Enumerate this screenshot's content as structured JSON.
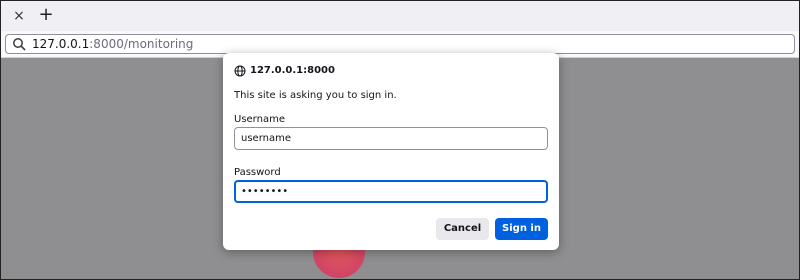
{
  "tabs": {
    "close_glyph": "×",
    "new_tab_glyph": "+"
  },
  "urlbar": {
    "host": "127.0.0.1",
    "rest": ":8000/monitoring"
  },
  "dialog": {
    "host": "127.0.0.1:8000",
    "message": "This site is asking you to sign in.",
    "username_label": "Username",
    "username_value": "username",
    "password_label": "Password",
    "password_value": "••••••••",
    "cancel_label": "Cancel",
    "signin_label": "Sign in"
  },
  "colors": {
    "accent": "#0061e0",
    "page_background": "#8f8e91"
  },
  "icons": [
    "search-icon",
    "globe-icon"
  ]
}
